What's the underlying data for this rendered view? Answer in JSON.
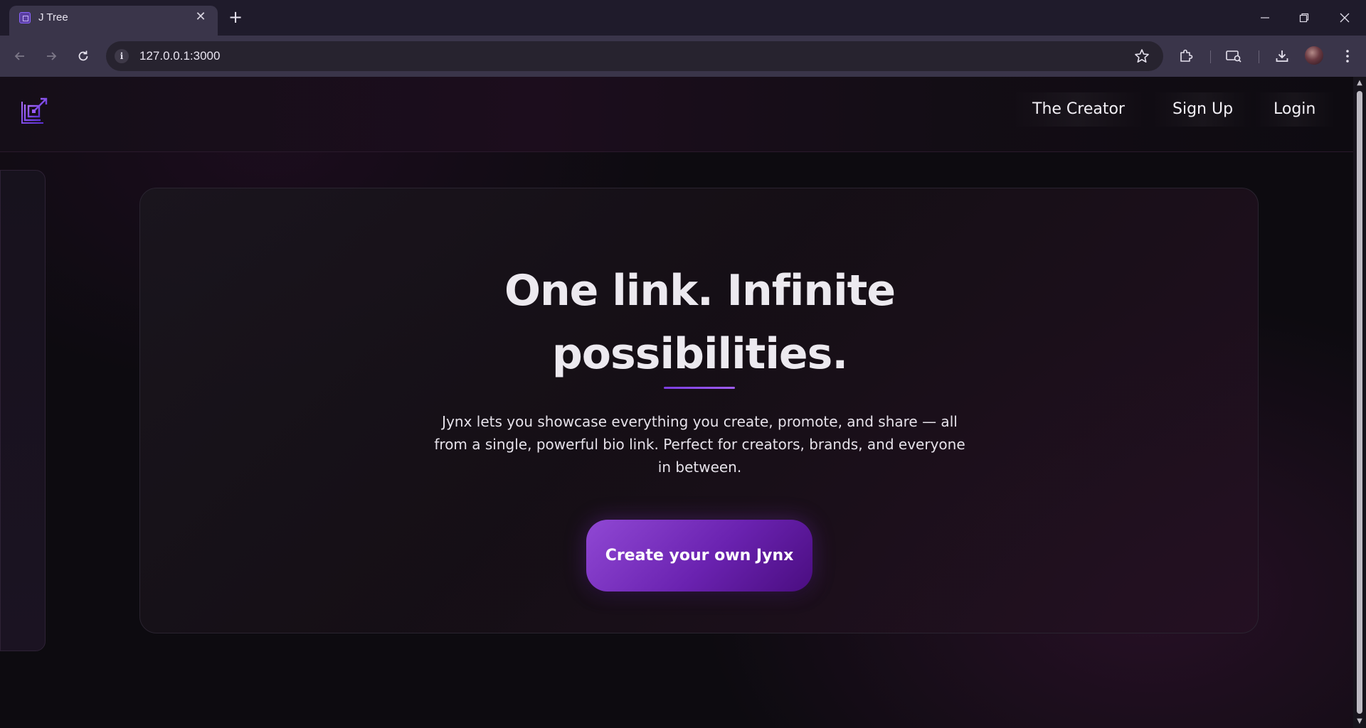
{
  "browser": {
    "tab_title": "J Tree",
    "tab_close_glyph": "✕",
    "new_tab_glyph": "+",
    "url": "127.0.0.1:3000",
    "window_controls": {
      "minimize": "—",
      "restore": "❐",
      "close": "✕"
    },
    "icons": {
      "back": "back-arrow-icon",
      "forward": "forward-arrow-icon",
      "reload": "reload-icon",
      "info": "site-info-icon",
      "bookmark": "star-icon",
      "extensions": "puzzle-icon",
      "cast": "cast-search-icon",
      "downloads": "download-icon",
      "menu": "kebab-menu-icon"
    }
  },
  "site": {
    "logo": "jynx-logo-icon",
    "nav": {
      "creator": "The Creator",
      "signup": "Sign Up",
      "login": "Login"
    },
    "hero": {
      "title_line1": "One link. Infinite",
      "title_line2": "possibilities.",
      "description": "Jynx lets you showcase everything you create, promote, and share — all from a single, powerful bio link. Perfect for creators, brands, and everyone in between.",
      "cta_label": "Create your own Jynx"
    }
  },
  "colors": {
    "accent": "#7c3ee0",
    "cta_gradient_start": "#9048d4",
    "cta_gradient_end": "#4a0d80",
    "page_background": "#0d0b10",
    "browser_chrome": "#3a354a"
  }
}
